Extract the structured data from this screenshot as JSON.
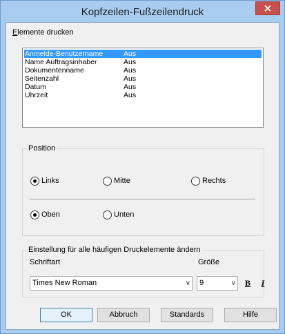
{
  "window": {
    "title": "Kopfzeilen-Fußzeilendruck"
  },
  "elements": {
    "legend": "Elemente drucken",
    "items": [
      {
        "name": "Anmelde-Benutzername",
        "value": "Aus"
      },
      {
        "name": "Name Auftragsinhaber",
        "value": "Aus"
      },
      {
        "name": "Dokumentenname",
        "value": "Aus"
      },
      {
        "name": "Seitenzahl",
        "value": "Aus"
      },
      {
        "name": "Datum",
        "value": "Aus"
      },
      {
        "name": "Uhrzeit",
        "value": "Aus"
      }
    ],
    "selected_index": 0
  },
  "position": {
    "legend": "Position",
    "horizontal": {
      "left": "Links",
      "center": "Mitte",
      "right": "Rechts",
      "selected": "Links"
    },
    "vertical": {
      "top": "Oben",
      "bottom": "Unten",
      "selected": "Oben"
    }
  },
  "font_settings": {
    "legend": "Einstellung für alle häufigen Druckelemente ändern",
    "font_label": "Schriftart",
    "font_value": "Times New Roman",
    "size_label": "Größe",
    "size_value": "9",
    "bold_label": "B",
    "italic_label": "I"
  },
  "buttons": {
    "ok": "OK",
    "cancel": "Abbruch",
    "defaults": "Standards",
    "help": "Hilfe"
  },
  "icons": {
    "close": "close-icon",
    "dropdown": "chevron-down-icon"
  },
  "colors": {
    "title_bg": "#a9cdf1",
    "close_btn": "#c7504d",
    "selection": "#3399ff"
  }
}
